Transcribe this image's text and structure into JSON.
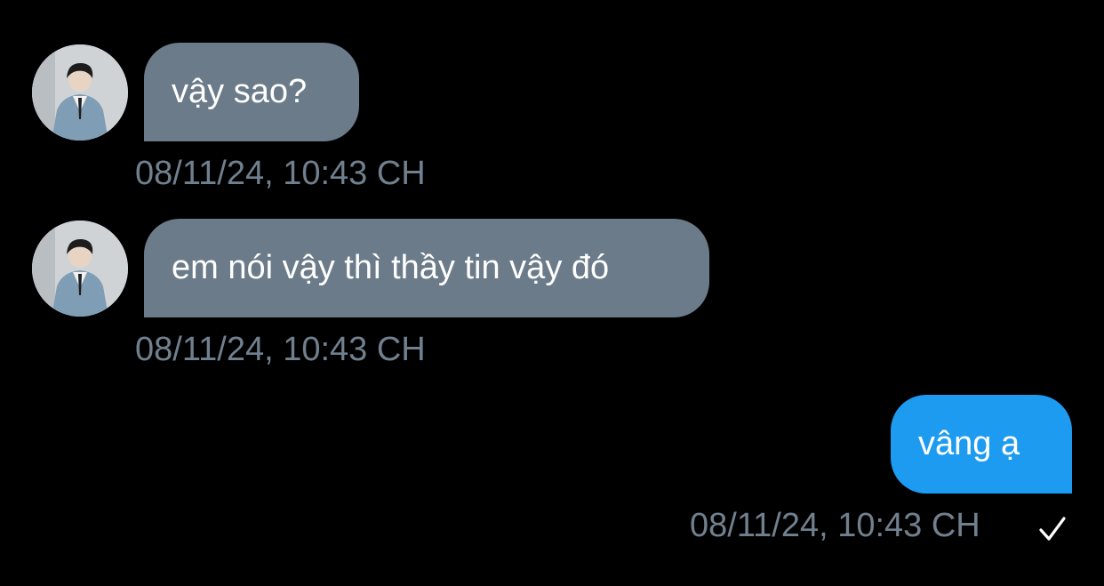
{
  "conversation": {
    "messages": [
      {
        "direction": "incoming",
        "text": "vậy sao?",
        "timestamp": "08/11/24, 10:43 CH"
      },
      {
        "direction": "incoming",
        "text": "em nói vậy thì thầy tin vậy đó",
        "timestamp": "08/11/24, 10:43 CH"
      },
      {
        "direction": "outgoing",
        "text": "vâng ạ",
        "timestamp": "08/11/24, 10:43 CH",
        "status_icon": "checkmark-icon"
      }
    ]
  },
  "colors": {
    "background": "#000000",
    "incoming_bubble": "#6b7b89",
    "outgoing_bubble": "#1d9bf0",
    "timestamp_text": "#71808e",
    "message_text": "#ffffff"
  },
  "icons": {
    "avatar": "profile-photo-avatar",
    "sent_status": "checkmark-icon"
  }
}
